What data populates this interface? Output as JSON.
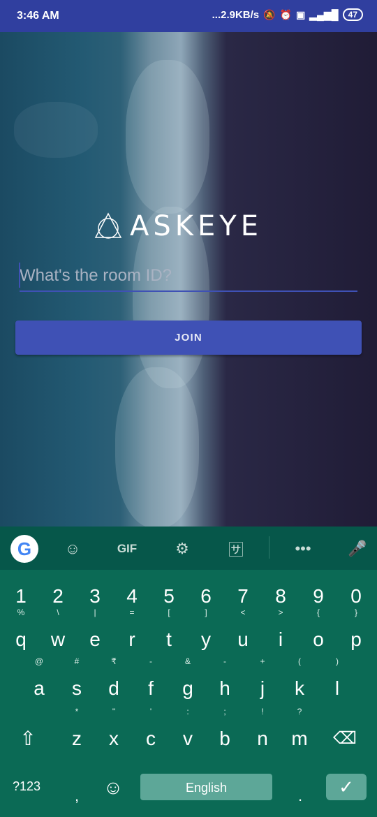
{
  "status_bar": {
    "time": "3:46 AM",
    "net_speed": "...2.9KB/s",
    "battery": "47"
  },
  "app": {
    "logo_text": "ASKEYE",
    "room_input_placeholder": "What's the room ID?",
    "room_input_value": "",
    "join_label": "JOIN",
    "accent_color": "#3f51b5"
  },
  "keyboard": {
    "toolbar": [
      "google-icon",
      "sticker-icon",
      "GIF",
      "settings-icon",
      "translate-icon",
      "more-icon",
      "mic-icon"
    ],
    "gif_label": "GIF",
    "numbers": [
      "1",
      "2",
      "3",
      "4",
      "5",
      "6",
      "7",
      "8",
      "9",
      "0"
    ],
    "row1": [
      {
        "k": "q",
        "h": "%"
      },
      {
        "k": "w",
        "h": "\\"
      },
      {
        "k": "e",
        "h": "|"
      },
      {
        "k": "r",
        "h": "="
      },
      {
        "k": "t",
        "h": "["
      },
      {
        "k": "y",
        "h": "]"
      },
      {
        "k": "u",
        "h": "<"
      },
      {
        "k": "i",
        "h": ">"
      },
      {
        "k": "o",
        "h": "{"
      },
      {
        "k": "p",
        "h": "}"
      }
    ],
    "row2": [
      {
        "k": "a",
        "h": "@"
      },
      {
        "k": "s",
        "h": "#"
      },
      {
        "k": "d",
        "h": "₹"
      },
      {
        "k": "f",
        "h": "-"
      },
      {
        "k": "g",
        "h": "&"
      },
      {
        "k": "h",
        "h": "-"
      },
      {
        "k": "j",
        "h": "+"
      },
      {
        "k": "k",
        "h": "("
      },
      {
        "k": "l",
        "h": ")"
      }
    ],
    "row3": [
      {
        "k": "z",
        "h": "*"
      },
      {
        "k": "x",
        "h": "\""
      },
      {
        "k": "c",
        "h": "'"
      },
      {
        "k": "v",
        "h": ":"
      },
      {
        "k": "b",
        "h": ";"
      },
      {
        "k": "n",
        "h": "!"
      },
      {
        "k": "m",
        "h": "?"
      }
    ],
    "sym_label": "?123",
    "comma": ",",
    "space_label": "English",
    "period": "."
  }
}
